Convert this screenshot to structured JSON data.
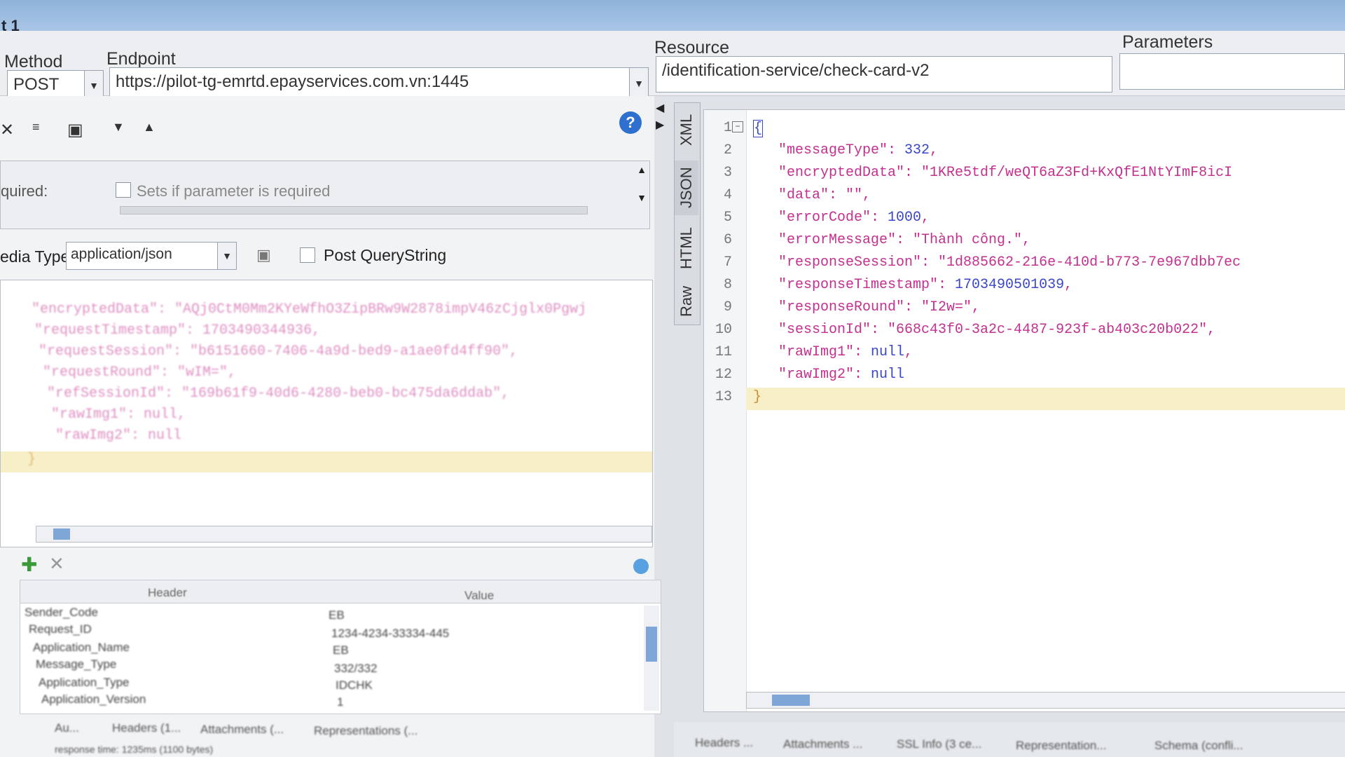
{
  "window": {
    "title": "t 1"
  },
  "request": {
    "method_label": "Method",
    "method_value": "POST",
    "endpoint_label": "Endpoint",
    "endpoint_value": "https://pilot-tg-emrtd.epayservices.com.vn:1445",
    "resource_label": "Resource",
    "resource_value": "/identification-service/check-card-v2",
    "parameters_label": "Parameters",
    "parameters_value": ""
  },
  "param_panel": {
    "required_label": "quired:",
    "required_hint": "Sets if parameter is required"
  },
  "media": {
    "label": "edia Type",
    "value": "application/json",
    "post_qs_label": "Post QueryString"
  },
  "request_body": {
    "lines": [
      "\"encryptedData\": \"AQj0CtM0Mm2KYeWfhO3ZipBRw9W2878impV46zCjglx0Pgwj",
      "\"requestTimestamp\": 1703490344936,",
      "\"requestSession\": \"b6151660-7406-4a9d-bed9-a1ae0fd4ff90\",",
      "\"requestRound\": \"wIM=\",",
      "\"refSessionId\": \"169b61f9-40d6-4280-beb0-bc475da6ddab\",",
      "\"rawImg1\": null,",
      "\"rawImg2\": null",
      "}"
    ]
  },
  "headers_table": {
    "col_header": "Header",
    "col_value": "Value",
    "rows": [
      {
        "name": "Sender_Code",
        "value": "EB"
      },
      {
        "name": "Request_ID",
        "value": "1234-4234-33334-445"
      },
      {
        "name": "Application_Name",
        "value": "EB"
      },
      {
        "name": "Message_Type",
        "value": "332/332"
      },
      {
        "name": "Application_Type",
        "value": "IDCHK"
      },
      {
        "name": "Application_Version",
        "value": "1"
      }
    ]
  },
  "left_bottom_tabs": [
    "Au...",
    "Headers (1...",
    "Attachments (...",
    "Representations (..."
  ],
  "status": {
    "response_time": "response time: 1235ms (1100 bytes)"
  },
  "response_tabs": [
    "XML",
    "JSON",
    "HTML",
    "Raw"
  ],
  "response_body": {
    "lines": [
      "{",
      "   \"messageType\": 332,",
      "   \"encryptedData\": \"1KRe5tdf/weQT6aZ3Fd+KxQfE1NtYImF8icI",
      "   \"data\": \"\",",
      "   \"errorCode\": 1000,",
      "   \"errorMessage\": \"Thành công.\",",
      "   \"responseSession\": \"1d885662-216e-410d-b773-7e967dbb7ec",
      "   \"responseTimestamp\": 1703490501039,",
      "   \"responseRound\": \"I2w=\",",
      "   \"sessionId\": \"668c43f0-3a2c-4487-923f-ab403c20b022\",",
      "   \"rawImg1\": null,",
      "   \"rawImg2\": null",
      "}"
    ],
    "line_numbers": [
      "1",
      "2",
      "3",
      "4",
      "5",
      "6",
      "7",
      "8",
      "9",
      "10",
      "11",
      "12",
      "13"
    ]
  },
  "right_bottom_tabs": [
    "Headers ...",
    "Attachments ...",
    "SSL Info (3 ce...",
    "Representation...",
    "Schema (confli..."
  ],
  "colors": {
    "string": "#c4308f",
    "number": "#3a46c8",
    "accent": "#2f6fd0"
  }
}
